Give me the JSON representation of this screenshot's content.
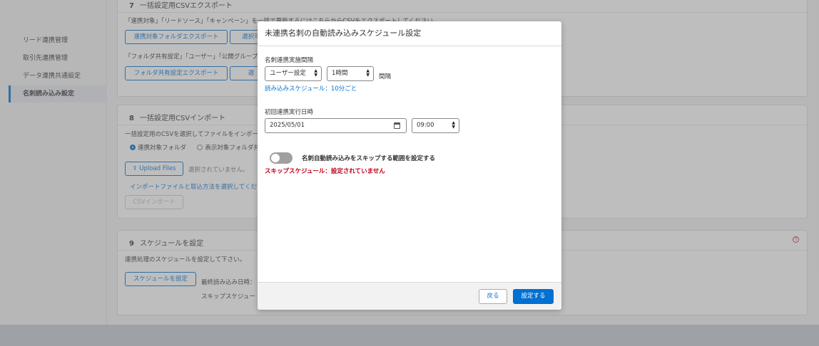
{
  "sidebar": {
    "items": [
      {
        "label": "リード連携管理"
      },
      {
        "label": "取引先連携管理"
      },
      {
        "label": "データ連携共通設定"
      },
      {
        "label": "名刺読み込み設定"
      }
    ]
  },
  "section7": {
    "number": "7",
    "title": "一括設定用CSVエクスポート",
    "desc1": "「連携対象」「リードソース」「キャンペーン」を一括で更新するにはこちらからCSVをエクスポートしてください。",
    "btn_folder_export": "連携対象フォルダエクスポート",
    "btn_select_partial": "選択可",
    "desc2": "「フォルダ共有設定」「ユーザー」「公開グループ",
    "btn_share_export": "フォルダ共有設定エクスポート",
    "btn_select2_partial": "選"
  },
  "section8": {
    "number": "8",
    "title": "一括設定用CSVインポート",
    "desc": "一括設定用のCSVを選択してファイルをインポー",
    "radio1": "連携対象フォルダ",
    "radio2": "表示対象フォルダ共",
    "upload_label": "Upload Files",
    "no_file": "選択されていません。",
    "link": "インポートファイルと取込方法を選択してくだ",
    "import_btn": "CSVインポート"
  },
  "section9": {
    "number": "9",
    "title": "スケジュールを設定",
    "desc": "連携処理のスケジュールを設定して下さい。",
    "btn": "スケジュールを設定",
    "last_read": "最終読み込み日時：",
    "skip_schedule": "スキップスケジュー"
  },
  "modal": {
    "title": "未連携名刺の自動読み込みスケジュール設定",
    "interval_label": "名刺連携実施間隔",
    "interval_type": "ユーザー設定",
    "interval_value": "1時間",
    "interval_suffix": "間隔",
    "schedule_note": "読み込みスケジュール：10分ごと",
    "first_run_label": "初回連携実行日時",
    "first_run_date": "2025/05/01",
    "first_run_time": "09:00",
    "toggle_label": "名刺自動読み込みをスキップする範囲を設定する",
    "skip_status": "スキップスケジュール：設定されていません",
    "back_btn": "戻る",
    "set_btn": "設定する"
  },
  "colors": {
    "accent": "#0070d2",
    "error": "#c0001a"
  }
}
